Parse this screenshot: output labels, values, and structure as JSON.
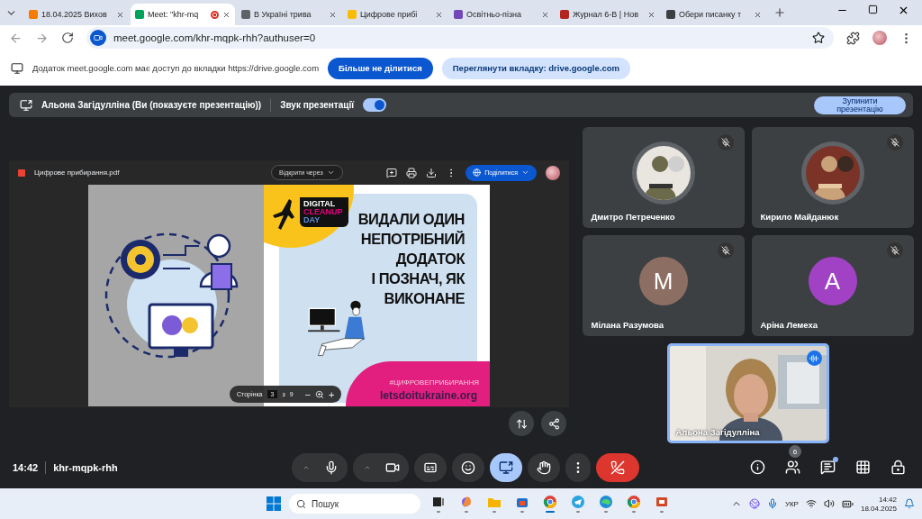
{
  "browser": {
    "tabs": [
      {
        "title": "18.04.2025 Вихов",
        "color": "#f57c00",
        "recording": false,
        "selected": false
      },
      {
        "title": "Meet: \"khr-mq",
        "color": "#00a35c",
        "recording": true,
        "selected": true
      },
      {
        "title": "В Україні трива",
        "color": "#5f6368",
        "recording": false,
        "selected": false
      },
      {
        "title": "Цифрове прибі",
        "color": "#fbbc04",
        "recording": false,
        "selected": false
      },
      {
        "title": "Освітньо-пізна",
        "color": "#7248b9",
        "recording": false,
        "selected": false
      },
      {
        "title": "Журнал 6-В | Нов",
        "color": "#b3261e",
        "recording": false,
        "selected": false
      },
      {
        "title": "Обери писанку т",
        "color": "#3c4043",
        "recording": false,
        "selected": false
      }
    ],
    "url": "meet.google.com/khr-mqpk-rhh?authuser=0"
  },
  "share_banner": {
    "message": "Додаток meet.google.com має доступ до вкладки https://drive.google.com",
    "buttons": [
      "Більше не ділитися",
      "Переглянути вкладку: drive.google.com"
    ]
  },
  "presenting_bar": {
    "text": "Альона Загідулліна (Ви (показуєте презентацію))",
    "audio_label": "Звук презентації",
    "audio_on": true,
    "stop_button": "Зупинити презентацію"
  },
  "pdf_viewer": {
    "file": "Цифрове прибирання.pdf",
    "open_with": "Відкрити через",
    "share": "Поділитися",
    "slide": {
      "logo": [
        {
          "text": "DIGITAL",
          "color": "#ffffff"
        },
        {
          "text": "CLEANUP",
          "color": "#e6007e"
        },
        {
          "text": "DAY",
          "color": "#5b8fd6"
        }
      ],
      "headline": [
        "ВИДАЛИ ОДИН",
        "НЕПОТРІБНИЙ",
        "ДОДАТОК",
        "І ПОЗНАЧ, ЯК",
        "ВИКОНАНЕ"
      ],
      "hashtag": "#ЦИФРОВЕПРИБИРАННЯ",
      "website": "letsdoitukraine.org"
    },
    "page_controls": {
      "label": "Сторінка",
      "current": "3",
      "of": "з",
      "total": "9",
      "zoom_out": "−",
      "zoom_in": "+"
    }
  },
  "participants": [
    {
      "name": "Дмитро Петреченко",
      "kind": "picture",
      "muted": true
    },
    {
      "name": "Кирило Майданюк",
      "kind": "picture",
      "muted": true
    },
    {
      "name": "Мілана Разумова",
      "kind": "letter",
      "letter": "М",
      "color": "#8d6e63",
      "muted": true
    },
    {
      "name": "Аріна Лемеха",
      "kind": "letter",
      "letter": "А",
      "color": "#a142c4",
      "muted": true
    }
  ],
  "self_view": {
    "name": "Альона Загідулліна",
    "speaking": true
  },
  "meeting_bar": {
    "time": "14:42",
    "code": "khr-mqpk-rhh",
    "controls": [
      {
        "kind": "mic",
        "active": false
      },
      {
        "kind": "camera",
        "active": false
      },
      {
        "kind": "captions",
        "active": false
      },
      {
        "kind": "emoji",
        "active": false
      },
      {
        "kind": "present",
        "active": true
      },
      {
        "kind": "hand",
        "active": false
      },
      {
        "kind": "more",
        "active": false
      },
      {
        "kind": "leave",
        "active": false
      }
    ],
    "side_controls": [
      {
        "kind": "info"
      },
      {
        "kind": "people",
        "badge": "6"
      },
      {
        "kind": "chat",
        "unread": true
      },
      {
        "kind": "apps"
      },
      {
        "kind": "host"
      }
    ]
  },
  "taskbar": {
    "search": "Пошук",
    "apps": [
      {
        "kind": "taskview",
        "active": false
      },
      {
        "kind": "copilot",
        "active": false
      },
      {
        "kind": "folder",
        "active": false
      },
      {
        "kind": "store",
        "active": false
      },
      {
        "kind": "browser",
        "active": true
      },
      {
        "kind": "telegram",
        "active": false
      },
      {
        "kind": "edge",
        "active": false
      },
      {
        "kind": "browser",
        "active": false
      },
      {
        "kind": "office",
        "active": false
      }
    ],
    "language": "УКР",
    "time": "14:42",
    "date": "18.04.2025"
  }
}
